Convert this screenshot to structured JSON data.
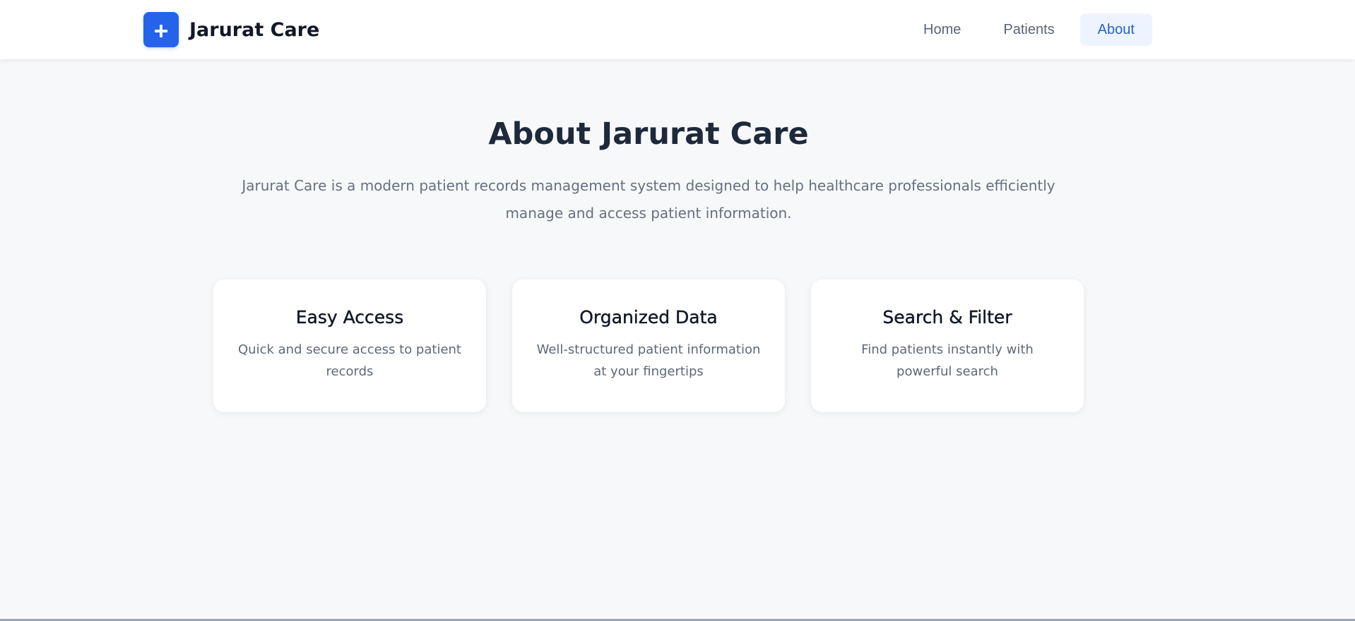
{
  "brand": {
    "name": "Jarurat Care",
    "logo_icon": "plus-icon",
    "accent_color": "#2563eb"
  },
  "nav": {
    "items": [
      {
        "label": "Home"
      },
      {
        "label": "Patients"
      },
      {
        "label": "About",
        "active": true
      }
    ]
  },
  "main": {
    "title": "About Jarurat Care",
    "description": "Jarurat Care is a modern patient records management system designed to help healthcare professionals efficiently manage and access patient information.",
    "features": [
      {
        "title": "Easy Access",
        "description": "Quick and secure access to patient records"
      },
      {
        "title": "Organized Data",
        "description": "Well-structured patient information at your fingertips"
      },
      {
        "title": "Search & Filter",
        "description": "Find patients instantly with powerful search"
      }
    ]
  }
}
